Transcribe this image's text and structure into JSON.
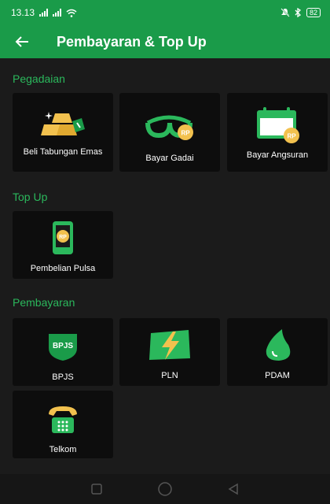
{
  "status": {
    "time": "13.13",
    "battery": "82"
  },
  "header": {
    "title": "Pembayaran & Top Up"
  },
  "sections": {
    "pegadaian": {
      "title": "Pegadaian",
      "items": [
        {
          "label": "Beli Tabungan Emas",
          "icon": "gold-bars-icon"
        },
        {
          "label": "Bayar Gadai",
          "icon": "scale-rp-icon"
        },
        {
          "label": "Bayar Angsuran",
          "icon": "calendar-rp-icon"
        }
      ]
    },
    "topup": {
      "title": "Top Up",
      "items": [
        {
          "label": "Pembelian Pulsa",
          "icon": "phone-rp-icon"
        }
      ]
    },
    "pembayaran": {
      "title": "Pembayaran",
      "items": [
        {
          "label": "BPJS",
          "icon": "bpjs-shield-icon"
        },
        {
          "label": "PLN",
          "icon": "lightning-icon"
        },
        {
          "label": "PDAM",
          "icon": "water-drop-icon"
        },
        {
          "label": "Telkom",
          "icon": "telephone-icon"
        }
      ]
    }
  },
  "icons": {
    "rp": "RP",
    "bpjs": "BPJS"
  },
  "colors": {
    "primary": "#1a9b49",
    "accent": "#2bb85c",
    "background": "#1b1b1b",
    "card": "#0d0d0d",
    "gold": "#f2c14e"
  }
}
